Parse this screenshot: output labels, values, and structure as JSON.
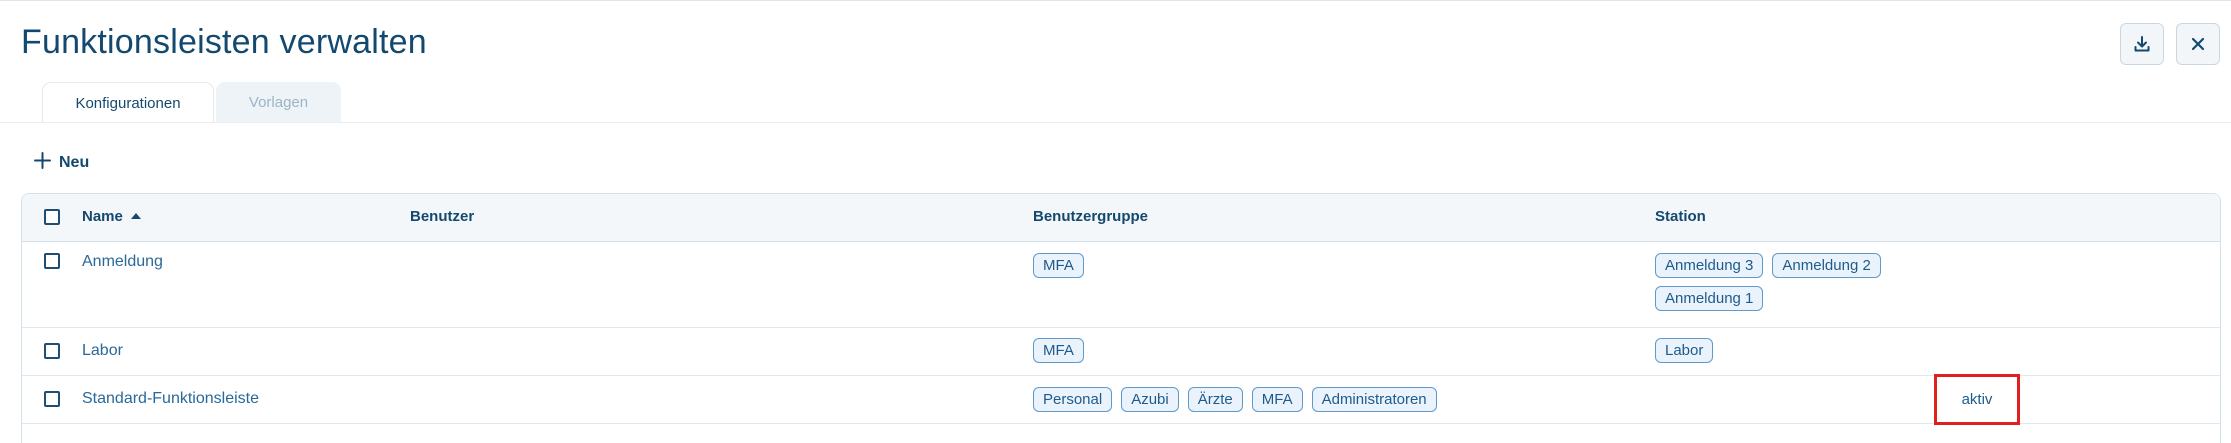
{
  "window": {
    "title": "Funktionsleisten verwalten",
    "download_icon": "download-icon",
    "close_icon": "close-icon"
  },
  "tabs": [
    {
      "label": "Konfigurationen",
      "active": true
    },
    {
      "label": "Vorlagen",
      "active": false
    }
  ],
  "toolbar": {
    "new_label": "Neu",
    "new_icon": "plus-icon"
  },
  "table": {
    "columns": {
      "name": "Name",
      "user": "Benutzer",
      "group": "Benutzergruppe",
      "station": "Station"
    },
    "sort": {
      "column": "Name",
      "direction": "ascending"
    },
    "rows": [
      {
        "name": "Anmeldung",
        "user": "",
        "groups": [
          "MFA"
        ],
        "stations": [
          "Anmeldung 3",
          "Anmeldung 2",
          "Anmeldung 1"
        ],
        "status": ""
      },
      {
        "name": "Labor",
        "user": "",
        "groups": [
          "MFA"
        ],
        "stations": [
          "Labor"
        ],
        "status": ""
      },
      {
        "name": "Standard-Funktionsleiste",
        "user": "",
        "groups": [
          "Personal",
          "Azubi",
          "Ärzte",
          "MFA",
          "Administratoren"
        ],
        "stations": [],
        "status": "aktiv"
      }
    ]
  },
  "colors": {
    "primary_text": "#14496f",
    "link_text": "#2a6899",
    "chip_border": "#5f9acb",
    "chip_background": "#eaf3fb",
    "highlight": "#e01f1f"
  }
}
